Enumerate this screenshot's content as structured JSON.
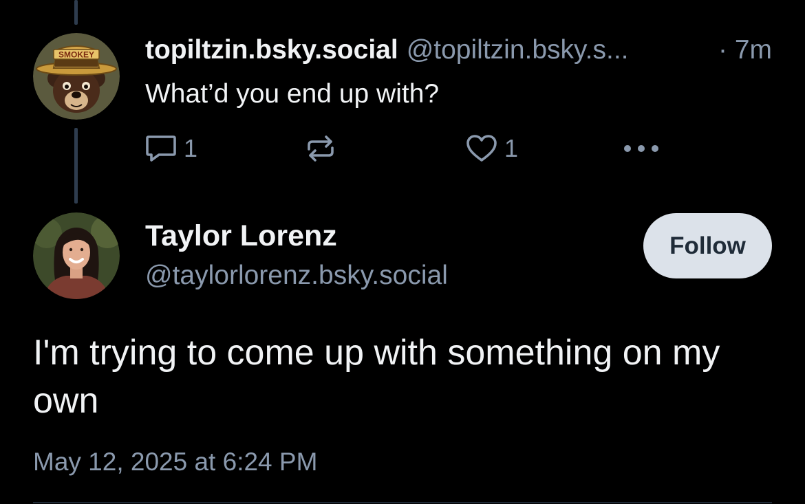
{
  "parent_post": {
    "display_name": "topiltzin.bsky.social",
    "handle": "@topiltzin.bsky.s...",
    "time": "· 7m",
    "text": "What’d you end up with?",
    "avatar_label": "SMOKEY",
    "reply_count": "1",
    "like_count": "1"
  },
  "main_post": {
    "display_name": "Taylor Lorenz",
    "handle": "@taylorlorenz.bsky.social",
    "follow_label": "Follow",
    "text": "I'm trying to come up with something on my own",
    "timestamp": "May 12, 2025 at 6:24 PM"
  },
  "icons": {
    "reply": "speech-bubble-icon",
    "repost": "repost-arrows-icon",
    "like": "heart-icon",
    "more": "ellipsis-icon"
  },
  "colors": {
    "background": "#000000",
    "primary_text": "#f1f3f5",
    "secondary_text": "#8a99ad",
    "thread_line": "#2e3c4e",
    "follow_button_bg": "#dce2ea",
    "follow_button_text": "#1f2b38"
  }
}
